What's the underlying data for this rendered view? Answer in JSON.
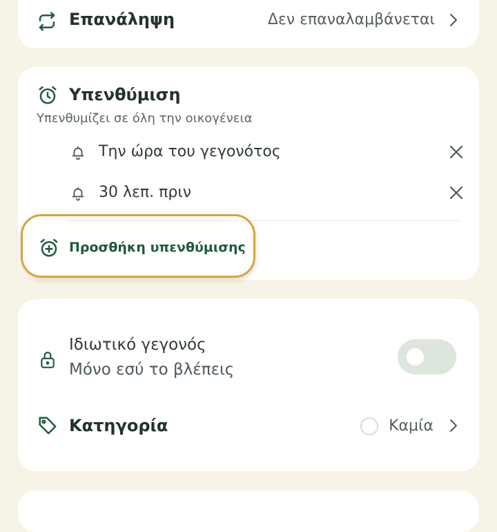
{
  "repeat": {
    "title": "Επανάληψη",
    "value": "Δεν επαναλαμβάνεται",
    "icon": "repeat-icon"
  },
  "reminder": {
    "title": "Υπενθύμιση",
    "subtitle": "Υπενθυμίζει σε όλη την οικογένεια",
    "icon": "alarm-clock-icon",
    "items": [
      {
        "label": "Την ώρα του γεγονότος"
      },
      {
        "label": "30 λεπ. πριν"
      }
    ],
    "add_label": "Προσθήκη υπενθύμισης"
  },
  "privacy": {
    "title": "Ιδιωτικό γεγονός",
    "subtitle": "Μόνο εσύ το βλέπεις",
    "toggle_on": false,
    "icon": "lock-icon"
  },
  "category": {
    "title": "Κατηγορία",
    "value": "Καμία",
    "icon": "tag-icon"
  },
  "colors": {
    "accent": "#1f5b3c",
    "background": "#f8f3e7",
    "highlight": "#d9a43c"
  }
}
